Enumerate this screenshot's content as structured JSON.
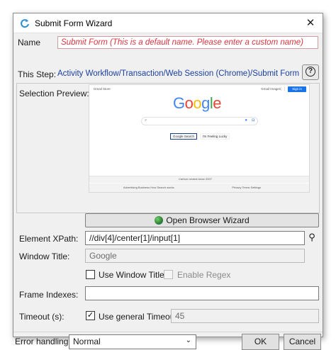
{
  "window": {
    "title": "Submit Form Wizard",
    "close_label": "✕"
  },
  "name": {
    "label": "Name",
    "value": "Submit Form  (This is a default name. Please enter a custom name)"
  },
  "step": {
    "label": "This Step:",
    "path": "Activity Workflow/Transaction/Web Session (Chrome)/Submit Form",
    "help_glyph": "?"
  },
  "preview": {
    "label": "Selection Preview:",
    "page": {
      "top_left": "Gmail   Store",
      "top_right": "Gmail   Images",
      "sign_in": "Sign in",
      "logo_letters": [
        "G",
        "o",
        "o",
        "g",
        "l",
        "e"
      ],
      "search_button": "Google Search",
      "lucky_button": "I'm Feeling Lucky",
      "footer_notice": "Carbon neutral since 2007",
      "footer_left": "Advertising    Business    How Search works",
      "footer_right": "Privacy    Terms    Settings"
    }
  },
  "open_browser_wizard": {
    "label": "Open Browser Wizard"
  },
  "xpath": {
    "label": "Element XPath:",
    "value": "//div[4]/center[1]/input[1]"
  },
  "window_title": {
    "label": "Window Title:",
    "value": "Google"
  },
  "use_window_title": {
    "label": "Use Window Title",
    "checked": false
  },
  "enable_regex": {
    "label": "Enable Regex",
    "checked": false
  },
  "frame_indexes": {
    "label": "Frame Indexes:",
    "value": ""
  },
  "timeout": {
    "label": "Timeout (s):",
    "use_general_label": "Use general Timeout",
    "use_general_checked": true,
    "value": "45"
  },
  "error_handling": {
    "label": "Error handling:",
    "selected": "Normal"
  },
  "buttons": {
    "ok": "OK",
    "cancel": "Cancel"
  },
  "colors": {
    "accent_blue": "#1a3f9e",
    "name_placeholder_red": "#d9333f"
  },
  "icons": [
    "app-refresh-icon",
    "close-icon",
    "help-icon",
    "globe-icon",
    "pin-icon",
    "checkmark-icon",
    "chevron-down-icon"
  ]
}
